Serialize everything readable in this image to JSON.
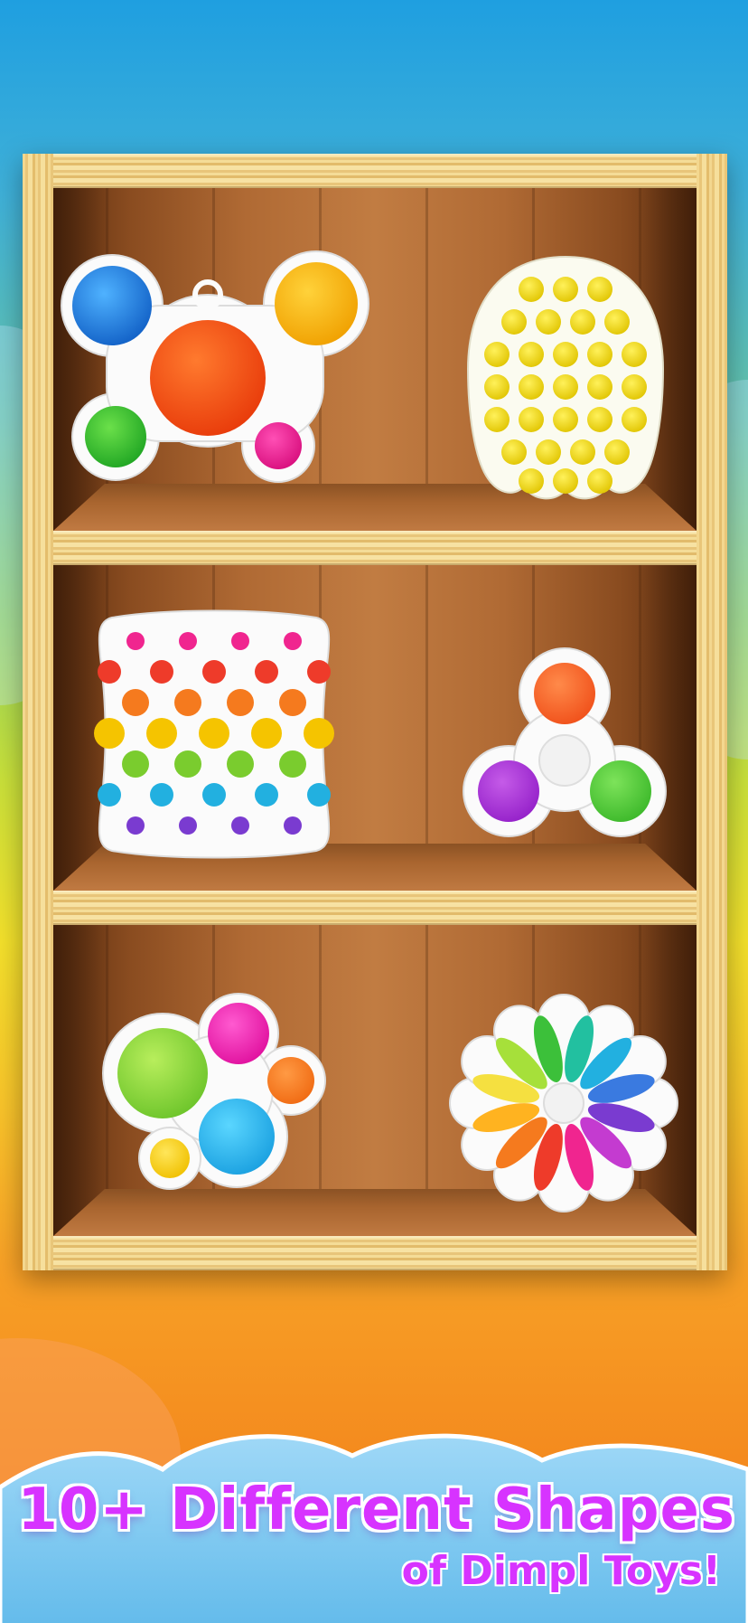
{
  "caption": {
    "headline": "10+ Different Shapes",
    "subline": "of Dimpl Toys!"
  },
  "colors": {
    "caption_text": "#d733ff",
    "caption_outline": "#ffffff",
    "shelf_wood_light": "#f2d894",
    "shelf_wood_dark": "#8a4c20",
    "toy_base": "#ffffff"
  },
  "shelves": [
    {
      "toys": [
        "butterfly-dimple-toy",
        "octopus-push-pop-toy"
      ]
    },
    {
      "toys": [
        "square-dimple-board-toy",
        "fidget-spinner-dimple-toy"
      ]
    },
    {
      "toys": [
        "flower-dimple-toy",
        "rainbow-wheel-dimple-toy"
      ]
    }
  ]
}
